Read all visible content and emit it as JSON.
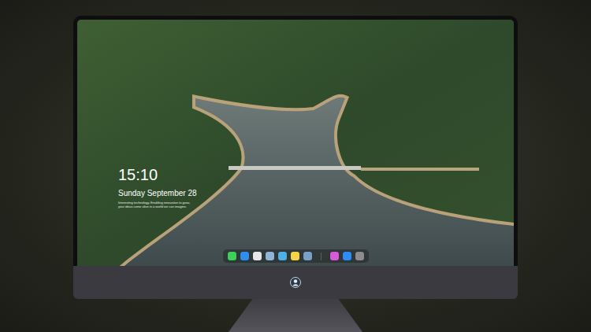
{
  "screen": {
    "clock": {
      "time": "15:10",
      "date": "Sunday September 28",
      "caption": [
        "Interesting technology. Enabling innovation to grow,",
        "your ideas come alive in a world we can imagine."
      ]
    }
  },
  "dock": {
    "apps": [
      {
        "color": "#3ecf5a"
      },
      {
        "color": "#2f8df0"
      },
      {
        "color": "#e6e6e6"
      },
      {
        "color": "#8fb4d8"
      },
      {
        "color": "#4fb0e8"
      },
      {
        "color": "#f5d547"
      },
      {
        "color": "#7aa0c8"
      }
    ],
    "extras": [
      {
        "color": "#d65bd8"
      },
      {
        "color": "#2e8df5"
      },
      {
        "color": "#8c8c8c"
      }
    ]
  }
}
